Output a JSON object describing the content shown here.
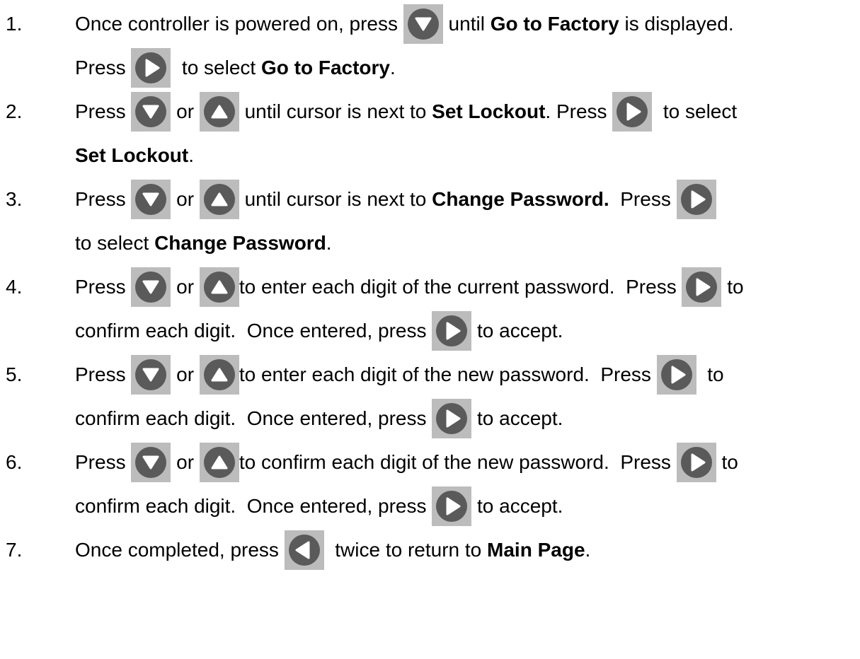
{
  "steps": [
    {
      "number": "1.",
      "lines": [
        [
          {
            "t": "text",
            "v": "Once controller is powered on, press "
          },
          {
            "t": "btn",
            "icon": "down"
          },
          {
            "t": "text",
            "v": " until "
          },
          {
            "t": "bold",
            "v": "Go to Factory"
          },
          {
            "t": "text",
            "v": " is displayed."
          }
        ],
        [
          {
            "t": "text",
            "v": "Press "
          },
          {
            "t": "btn",
            "icon": "right"
          },
          {
            "t": "text",
            "v": "  to select "
          },
          {
            "t": "bold",
            "v": "Go to Factory"
          },
          {
            "t": "text",
            "v": "."
          }
        ]
      ]
    },
    {
      "number": "2.",
      "lines": [
        [
          {
            "t": "text",
            "v": "Press "
          },
          {
            "t": "btn",
            "icon": "down"
          },
          {
            "t": "text",
            "v": " or "
          },
          {
            "t": "btn",
            "icon": "up"
          },
          {
            "t": "text",
            "v": " until cursor is next to "
          },
          {
            "t": "bold",
            "v": "Set Lockout"
          },
          {
            "t": "text",
            "v": ". Press "
          },
          {
            "t": "btn",
            "icon": "right"
          },
          {
            "t": "text",
            "v": "  to select"
          }
        ],
        [
          {
            "t": "bold",
            "v": "Set Lockout"
          },
          {
            "t": "text",
            "v": "."
          }
        ]
      ]
    },
    {
      "number": "3.",
      "lines": [
        [
          {
            "t": "text",
            "v": "Press "
          },
          {
            "t": "btn",
            "icon": "down"
          },
          {
            "t": "text",
            "v": " or "
          },
          {
            "t": "btn",
            "icon": "up"
          },
          {
            "t": "text",
            "v": " until cursor is next to "
          },
          {
            "t": "bold",
            "v": "Change Password."
          },
          {
            "t": "text",
            "v": "  Press "
          },
          {
            "t": "btn",
            "icon": "right"
          }
        ],
        [
          {
            "t": "text",
            "v": "to select "
          },
          {
            "t": "bold",
            "v": "Change Password"
          },
          {
            "t": "text",
            "v": "."
          }
        ]
      ]
    },
    {
      "number": "4.",
      "lines": [
        [
          {
            "t": "text",
            "v": "Press "
          },
          {
            "t": "btn",
            "icon": "down"
          },
          {
            "t": "text",
            "v": " or "
          },
          {
            "t": "btn",
            "icon": "up"
          },
          {
            "t": "text",
            "v": "to enter each digit of the current password.  Press "
          },
          {
            "t": "btn",
            "icon": "right"
          },
          {
            "t": "text",
            "v": " to"
          }
        ],
        [
          {
            "t": "text",
            "v": "confirm each digit.  Once entered, press "
          },
          {
            "t": "btn",
            "icon": "right"
          },
          {
            "t": "text",
            "v": " to accept."
          }
        ]
      ]
    },
    {
      "number": "5.",
      "lines": [
        [
          {
            "t": "text",
            "v": "Press "
          },
          {
            "t": "btn",
            "icon": "down"
          },
          {
            "t": "text",
            "v": " or "
          },
          {
            "t": "btn",
            "icon": "up"
          },
          {
            "t": "text",
            "v": "to enter each digit of the new password.  Press "
          },
          {
            "t": "btn",
            "icon": "right"
          },
          {
            "t": "text",
            "v": "  to"
          }
        ],
        [
          {
            "t": "text",
            "v": "confirm each digit.  Once entered, press "
          },
          {
            "t": "btn",
            "icon": "right"
          },
          {
            "t": "text",
            "v": " to accept."
          }
        ]
      ]
    },
    {
      "number": "6.",
      "lines": [
        [
          {
            "t": "text",
            "v": "Press "
          },
          {
            "t": "btn",
            "icon": "down"
          },
          {
            "t": "text",
            "v": " or "
          },
          {
            "t": "btn",
            "icon": "up"
          },
          {
            "t": "text",
            "v": "to confirm each digit of the new password.  Press "
          },
          {
            "t": "btn",
            "icon": "right"
          },
          {
            "t": "text",
            "v": " to"
          }
        ],
        [
          {
            "t": "text",
            "v": "confirm each digit.  Once entered, press "
          },
          {
            "t": "btn",
            "icon": "right"
          },
          {
            "t": "text",
            "v": " to accept."
          }
        ]
      ]
    },
    {
      "number": "7.",
      "lines": [
        [
          {
            "t": "text",
            "v": "Once completed, press "
          },
          {
            "t": "btn",
            "icon": "left"
          },
          {
            "t": "text",
            "v": "  twice to return to "
          },
          {
            "t": "bold",
            "v": "Main Page"
          },
          {
            "t": "text",
            "v": "."
          }
        ]
      ]
    }
  ],
  "colors": {
    "button_background": "#bcbcbc",
    "button_circle": "#5a5a5a",
    "arrow": "#ffffff",
    "text": "#000000"
  },
  "icons": {
    "down": "down-arrow-icon",
    "up": "up-arrow-icon",
    "right": "right-arrow-icon",
    "left": "left-arrow-icon"
  }
}
